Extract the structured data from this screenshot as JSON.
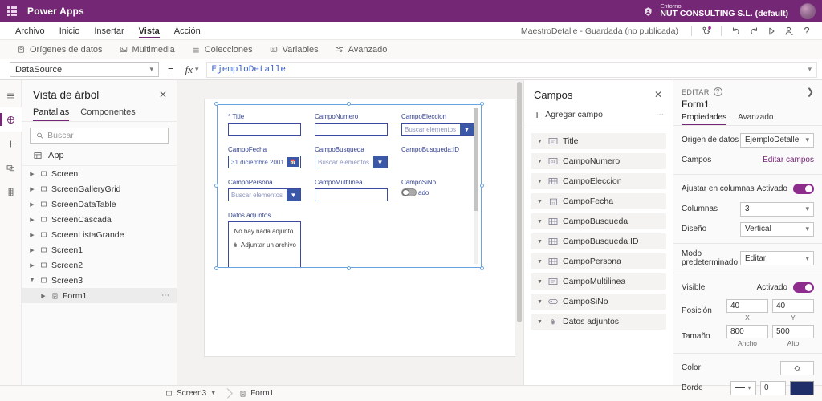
{
  "topbar": {
    "waffle_icon": "waffle-grid-icon",
    "brand": "Power Apps",
    "env_label": "Entorno",
    "env_name": "NUT CONSULTING S.L. (default)",
    "env_icon": "environment-icon",
    "avatar": "user-avatar"
  },
  "menubar": {
    "items": [
      {
        "label": "Archivo",
        "active": false
      },
      {
        "label": "Inicio",
        "active": false
      },
      {
        "label": "Insertar",
        "active": false
      },
      {
        "label": "Vista",
        "active": true
      },
      {
        "label": "Acción",
        "active": false
      }
    ],
    "saved_status": "MaestroDetalle - Guardada (no publicada)",
    "icons": [
      {
        "name": "app-checker-icon",
        "glyph": "checker"
      },
      {
        "name": "undo-icon",
        "glyph": "undo"
      },
      {
        "name": "redo-icon",
        "glyph": "redo"
      },
      {
        "name": "preview-play-icon",
        "glyph": "play"
      },
      {
        "name": "share-person-icon",
        "glyph": "person"
      },
      {
        "name": "help-icon",
        "glyph": "?"
      }
    ]
  },
  "ribbon": {
    "items": [
      {
        "label": "Orígenes de datos",
        "icon": "database-icon"
      },
      {
        "label": "Multimedia",
        "icon": "media-icon"
      },
      {
        "label": "Colecciones",
        "icon": "collections-icon"
      },
      {
        "label": "Variables",
        "icon": "variables-icon"
      },
      {
        "label": "Avanzado",
        "icon": "advanced-icon"
      }
    ]
  },
  "formula_bar": {
    "property": "DataSource",
    "equals": "=",
    "fx_label": "fx",
    "value": "EjemploDetalle"
  },
  "rail": {
    "items": [
      {
        "name": "hamburger-menu-icon",
        "selected": false
      },
      {
        "name": "tree-view-icon",
        "selected": true
      },
      {
        "name": "insert-plus-icon",
        "selected": false
      },
      {
        "name": "data-sources-icon",
        "selected": false
      },
      {
        "name": "media-library-icon",
        "selected": false
      }
    ]
  },
  "tree_panel": {
    "title": "Vista de árbol",
    "close_icon": "close-icon",
    "tabs": [
      {
        "label": "Pantallas",
        "active": true
      },
      {
        "label": "Componentes",
        "active": false
      }
    ],
    "search_placeholder": "Buscar",
    "search_value": "",
    "app_item": "App",
    "items": [
      {
        "label": "Screen",
        "expanded": false,
        "child": false,
        "selected": false
      },
      {
        "label": "ScreenGalleryGrid",
        "expanded": false,
        "child": false,
        "selected": false
      },
      {
        "label": "ScreenDataTable",
        "expanded": false,
        "child": false,
        "selected": false
      },
      {
        "label": "ScreenCascada",
        "expanded": false,
        "child": false,
        "selected": false
      },
      {
        "label": "ScreenListaGrande",
        "expanded": false,
        "child": false,
        "selected": false
      },
      {
        "label": "Screen1",
        "expanded": false,
        "child": false,
        "selected": false
      },
      {
        "label": "Screen2",
        "expanded": false,
        "child": false,
        "selected": false
      },
      {
        "label": "Screen3",
        "expanded": true,
        "child": false,
        "selected": false
      },
      {
        "label": "Form1",
        "expanded": false,
        "child": true,
        "selected": true
      }
    ]
  },
  "canvas": {
    "form_fields": [
      {
        "label": "Title",
        "required": true,
        "control": "text",
        "value": "",
        "placeholder": "",
        "col": 0,
        "row": 0
      },
      {
        "label": "CampoNumero",
        "required": false,
        "control": "text",
        "value": "",
        "placeholder": "",
        "col": 1,
        "row": 0
      },
      {
        "label": "CampoEleccion",
        "required": false,
        "control": "combo",
        "value": "",
        "placeholder": "Buscar elementos",
        "col": 2,
        "row": 0
      },
      {
        "label": "CampoFecha",
        "required": false,
        "control": "date",
        "value": "31 diciembre 2001",
        "placeholder": "",
        "col": 0,
        "row": 1
      },
      {
        "label": "CampoBusqueda",
        "required": false,
        "control": "combo",
        "value": "",
        "placeholder": "Buscar elementos",
        "col": 1,
        "row": 1
      },
      {
        "label": "CampoBusqueda:ID",
        "required": false,
        "control": "none",
        "value": "",
        "placeholder": "",
        "col": 2,
        "row": 1
      },
      {
        "label": "CampoPersona",
        "required": false,
        "control": "combo",
        "value": "",
        "placeholder": "Buscar elementos",
        "col": 0,
        "row": 2
      },
      {
        "label": "CampoMultilinea",
        "required": false,
        "control": "text",
        "value": "",
        "placeholder": "",
        "col": 1,
        "row": 2
      },
      {
        "label": "CampoSiNo",
        "required": false,
        "control": "toggle",
        "value": "ado",
        "placeholder": "",
        "col": 2,
        "row": 2
      },
      {
        "label": "Datos adjuntos",
        "required": false,
        "control": "attachment",
        "value": "",
        "placeholder": "",
        "col": 0,
        "row": 3
      }
    ],
    "attachment": {
      "empty_text": "No hay nada adjunto.",
      "attach_label": "Adjuntar un archivo",
      "clip_icon": "paperclip-icon"
    }
  },
  "fields_panel": {
    "title": "Campos",
    "close_icon": "close-icon",
    "add_field": "Agregar campo",
    "more_icon": "more-options-icon",
    "items": [
      {
        "label": "Title",
        "icon": "text-field-icon"
      },
      {
        "label": "CampoNumero",
        "icon": "number-field-icon"
      },
      {
        "label": "CampoEleccion",
        "icon": "choice-field-icon"
      },
      {
        "label": "CampoFecha",
        "icon": "date-field-icon"
      },
      {
        "label": "CampoBusqueda",
        "icon": "lookup-field-icon"
      },
      {
        "label": "CampoBusqueda:ID",
        "icon": "lookup-field-icon"
      },
      {
        "label": "CampoPersona",
        "icon": "person-field-icon"
      },
      {
        "label": "CampoMultilinea",
        "icon": "text-field-icon"
      },
      {
        "label": "CampoSiNo",
        "icon": "toggle-field-icon"
      },
      {
        "label": "Datos adjuntos",
        "icon": "paperclip-icon"
      }
    ]
  },
  "props_panel": {
    "edit_label": "EDITAR",
    "help_icon": "help-circle-icon",
    "collapse_icon": "chevron-right-icon",
    "control_name": "Form1",
    "tabs": [
      {
        "label": "Propiedades",
        "active": true
      },
      {
        "label": "Avanzado",
        "active": false
      }
    ],
    "data_source_label": "Origen de datos",
    "data_source_value": "EjemploDetalle",
    "fields_label": "Campos",
    "edit_fields_link": "Editar campos",
    "snap_label": "Ajustar en columnas",
    "snap_state": "Activado",
    "columns_label": "Columnas",
    "columns_value": "3",
    "layout_label": "Diseño",
    "layout_value": "Vertical",
    "default_mode_label": "Modo predeterminado",
    "default_mode_value": "Editar",
    "visible_label": "Visible",
    "visible_state": "Activado",
    "position_label": "Posición",
    "position_x": "40",
    "position_y": "40",
    "position_x_cap": "X",
    "position_y_cap": "Y",
    "size_label": "Tamaño",
    "size_w": "800",
    "size_h": "500",
    "size_w_cap": "Ancho",
    "size_h_cap": "Alto",
    "color_label": "Color",
    "color_icon": "fill-color-icon",
    "border_label": "Borde",
    "border_width": "0",
    "border_color": "#1f2d68"
  },
  "bottombar": {
    "screen_crumb": "Screen3",
    "control_crumb": "Form1",
    "screen_icon": "screen-icon",
    "form_icon": "form-icon"
  },
  "colors": {
    "brand_purple": "#742774",
    "accent_blue": "#3b57a8",
    "field_label_blue": "#33418e",
    "selection_blue": "#6ba3e0",
    "toggle_on": "#8d2c8d"
  }
}
